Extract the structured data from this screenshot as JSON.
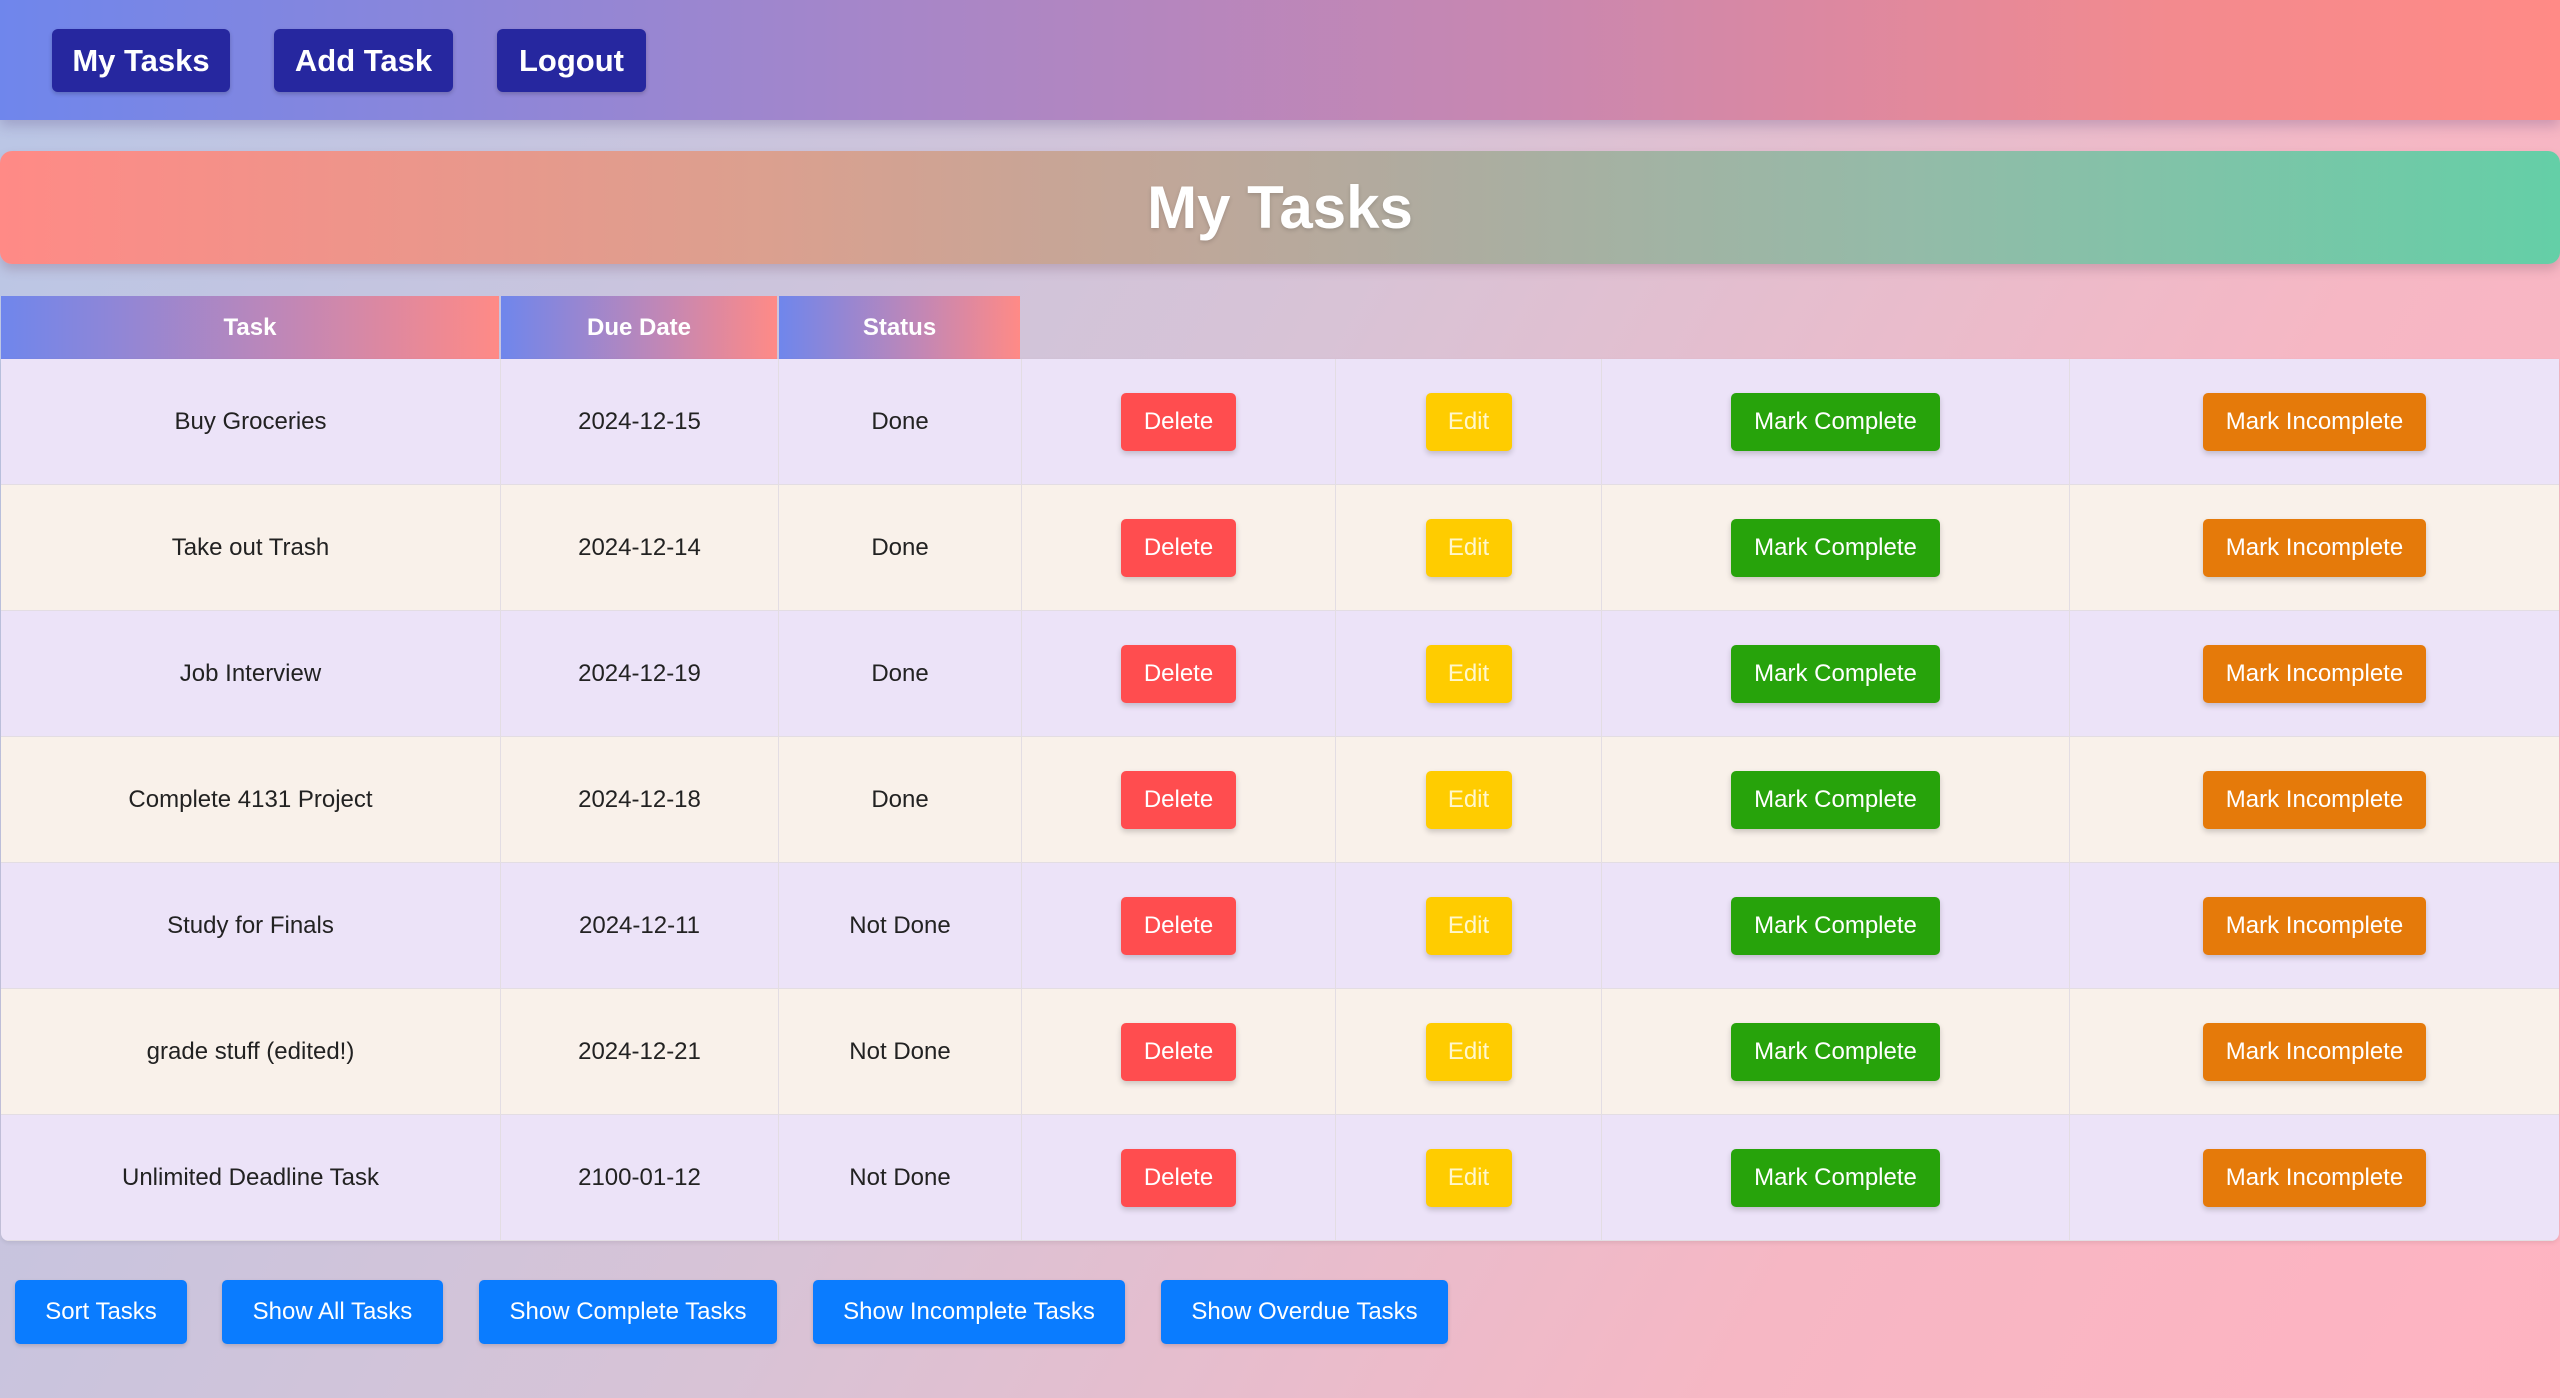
{
  "nav": {
    "my_tasks": "My Tasks",
    "add_task": "Add Task",
    "logout": "Logout"
  },
  "page_title": "My Tasks",
  "table": {
    "headers": [
      "Task",
      "Due Date",
      "Status"
    ],
    "rows": [
      {
        "task": "Buy Groceries",
        "due": "2024-12-15",
        "status": "Done"
      },
      {
        "task": "Take out Trash",
        "due": "2024-12-14",
        "status": "Done"
      },
      {
        "task": "Job Interview",
        "due": "2024-12-19",
        "status": "Done"
      },
      {
        "task": "Complete 4131 Project",
        "due": "2024-12-18",
        "status": "Done"
      },
      {
        "task": "Study for Finals",
        "due": "2024-12-11",
        "status": "Not Done"
      },
      {
        "task": "grade stuff (edited!)",
        "due": "2024-12-21",
        "status": "Not Done"
      },
      {
        "task": "Unlimited Deadline Task",
        "due": "2100-01-12",
        "status": "Not Done"
      }
    ],
    "actions": {
      "delete": "Delete",
      "edit": "Edit",
      "mark_complete": "Mark Complete",
      "mark_incomplete": "Mark Incomplete"
    }
  },
  "filters": {
    "sort": "Sort Tasks",
    "show_all": "Show All Tasks",
    "show_complete": "Show Complete Tasks",
    "show_incomplete": "Show Incomplete Tasks",
    "show_overdue": "Show Overdue Tasks"
  },
  "colors": {
    "nav_button": "#26279f",
    "delete": "#ff4d4f",
    "edit": "#ffcc00",
    "mark_complete": "#27a30b",
    "mark_incomplete": "#e57a0a",
    "filter_button": "#0a7cff"
  }
}
